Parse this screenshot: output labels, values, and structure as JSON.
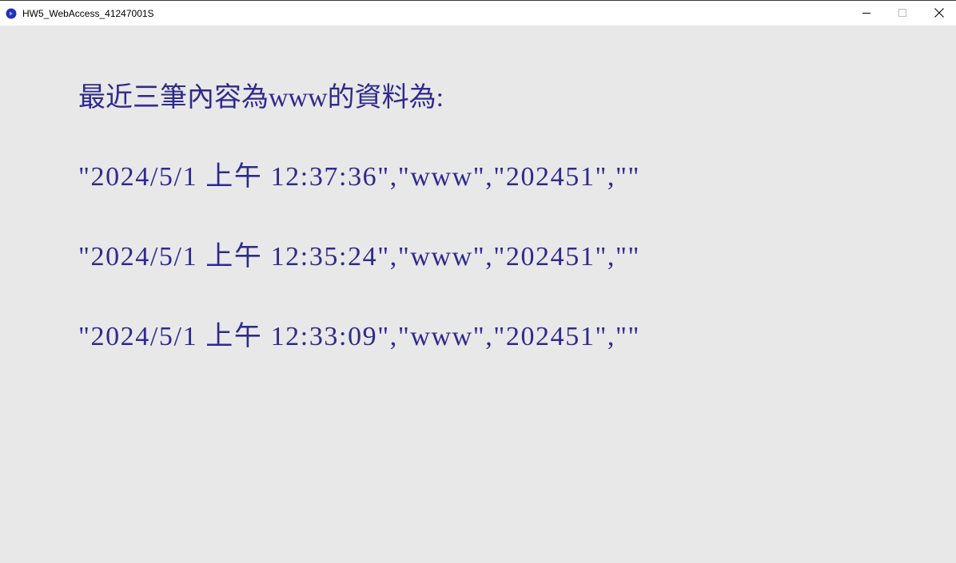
{
  "window": {
    "title": "HW5_WebAccess_41247001S",
    "icon": "processing-app-icon",
    "controls": {
      "minimize_icon": "minimize-icon",
      "maximize_icon": "maximize-icon",
      "close_icon": "close-icon"
    }
  },
  "main": {
    "heading": "最近三筆內容為www的資料為:",
    "records": [
      "\"2024/5/1 上午 12:37:36\",\"www\",\"202451\",\"\"",
      "\"2024/5/1 上午 12:35:24\",\"www\",\"202451\",\"\"",
      "\"2024/5/1 上午 12:33:09\",\"www\",\"202451\",\"\""
    ]
  },
  "colors": {
    "background": "#e8e8e8",
    "text": "#2e2a8c",
    "titlebar": "#ffffff",
    "app_icon": "#1f33b8"
  }
}
